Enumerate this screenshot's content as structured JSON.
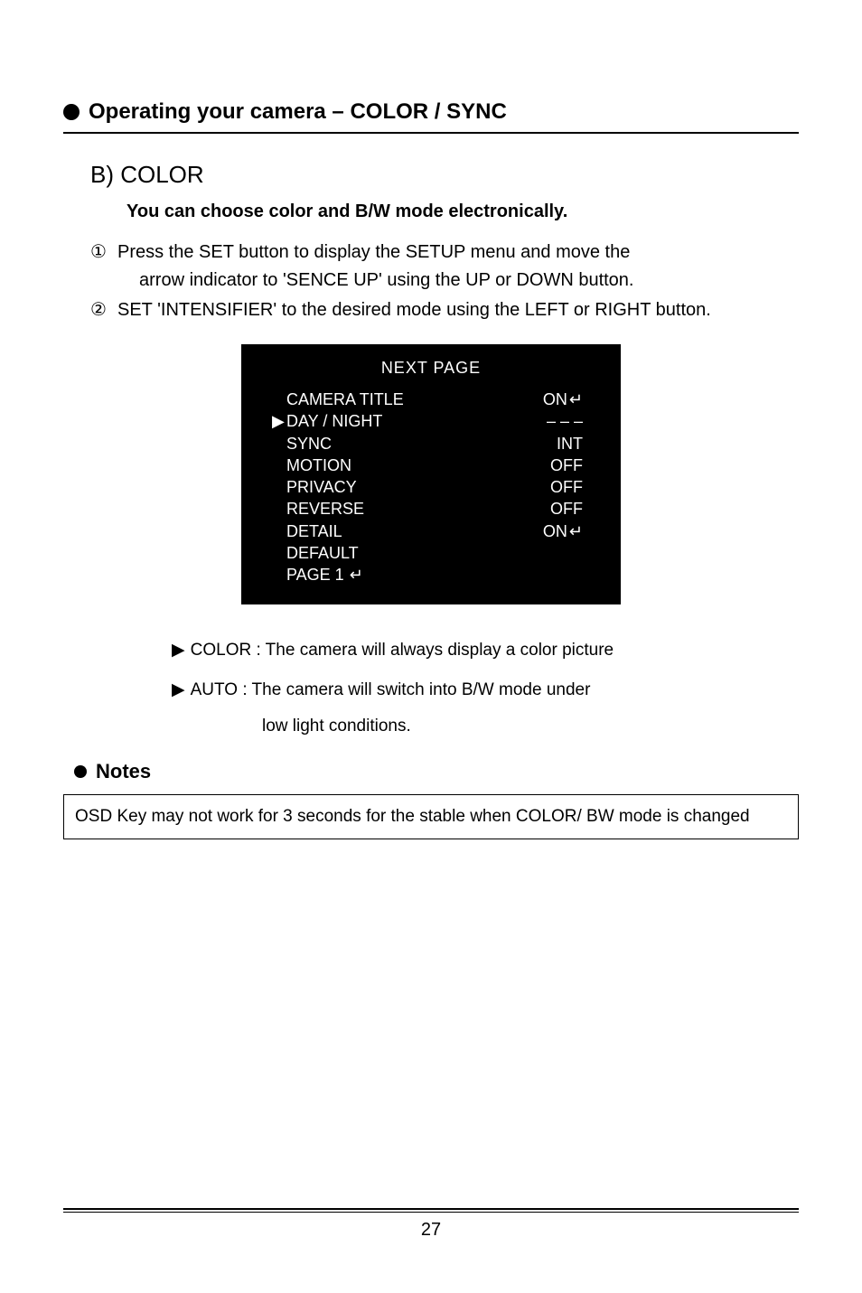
{
  "heading": "Operating your camera – COLOR / SYNC",
  "section_label": "B) COLOR",
  "intro": "You can choose color and B/W mode electronically.",
  "step1_num": "①",
  "step1_a": "Press the SET button to display the SETUP menu and move the",
  "step1_b": "arrow indicator to 'SENCE UP' using the UP or DOWN button.",
  "step2_num": "②",
  "step2": "SET 'INTENSIFIER' to the desired mode using the LEFT or RIGHT button.",
  "osd": {
    "title": "NEXT  PAGE",
    "rows": [
      {
        "label": "CAMERA  TITLE",
        "value": "ON",
        "enter": true,
        "pointer": false
      },
      {
        "label": "DAY / NIGHT",
        "value": "– – –",
        "enter": false,
        "pointer": true
      },
      {
        "label": "SYNC",
        "value": "INT",
        "enter": false,
        "pointer": false
      },
      {
        "label": "MOTION",
        "value": "OFF",
        "enter": false,
        "pointer": false
      },
      {
        "label": "PRIVACY",
        "value": "OFF",
        "enter": false,
        "pointer": false
      },
      {
        "label": "REVERSE",
        "value": "OFF",
        "enter": false,
        "pointer": false
      },
      {
        "label": "DETAIL",
        "value": "ON",
        "enter": true,
        "pointer": false
      },
      {
        "label": "DEFAULT",
        "value": "",
        "enter": false,
        "pointer": false
      },
      {
        "label": "PAGE 1",
        "value": "",
        "enter": false,
        "pointer": false,
        "label_enter": true
      }
    ]
  },
  "opt_color": "COLOR : The camera will always display a color picture",
  "opt_auto_a": "AUTO : The camera will switch into B/W mode under",
  "opt_auto_b": "low light conditions.",
  "notes_label": "Notes",
  "notes_body": "OSD Key may not work for 3 seconds for the stable when COLOR/ BW mode is changed",
  "page_number": "27"
}
